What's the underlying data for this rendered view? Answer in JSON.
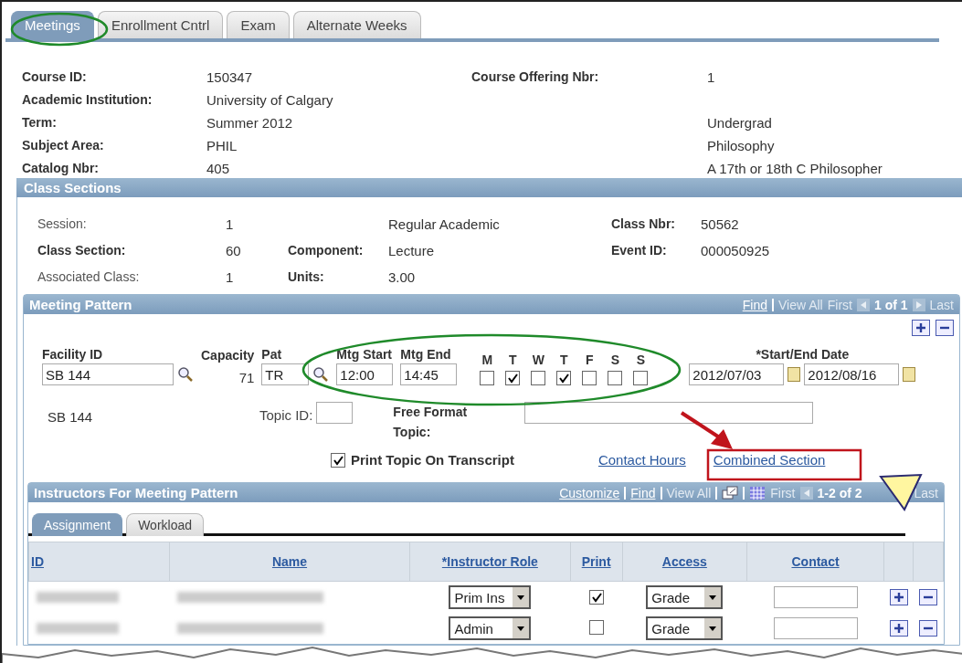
{
  "tabs": [
    {
      "label": "Meetings",
      "selected": true
    },
    {
      "label": "Enrollment Cntrl",
      "selected": false
    },
    {
      "label": "Exam",
      "selected": false
    },
    {
      "label": "Alternate Weeks",
      "selected": false
    }
  ],
  "course": [
    {
      "label": "Course ID:",
      "value": "150347",
      "right_label": "Course Offering Nbr:",
      "right_value": "1"
    },
    {
      "label": "Academic Institution:",
      "value": "University of Calgary"
    },
    {
      "label": "Term:",
      "value": "Summer 2012",
      "right_value": "Undergrad"
    },
    {
      "label": "Subject Area:",
      "value": "PHIL",
      "right_value": "Philosophy"
    },
    {
      "label": "Catalog Nbr:",
      "value": "405",
      "right_value": "A 17th or 18th C Philosopher"
    }
  ],
  "class_sections": {
    "title": "Class Sections",
    "rows": [
      {
        "label": "Session:",
        "bold": false,
        "value": "1",
        "mid_value": "Regular Academic",
        "right_label": "Class Nbr:",
        "right_value": "50562"
      },
      {
        "label": "Class Section:",
        "bold": true,
        "value": "60",
        "mid_label": "Component:",
        "mid_value": "Lecture",
        "right_label": "Event ID:",
        "right_value": "000050925"
      },
      {
        "label": "Associated Class:",
        "bold": false,
        "value": "1",
        "mid_label": "Units:",
        "mid_value": "3.00"
      }
    ]
  },
  "meeting_pattern": {
    "title": "Meeting Pattern",
    "nav": {
      "find": "Find",
      "view_all": "View All",
      "first": "First",
      "count": "1 of 1",
      "last": "Last"
    },
    "facility_label": "Facility ID",
    "facility": "SB 144",
    "capacity_label": "Capacity",
    "capacity": "71",
    "pat_label": "Pat",
    "pat": "TR",
    "start_label": "Mtg Start",
    "start": "12:00",
    "end_label": "Mtg End",
    "end": "14:45",
    "days": [
      {
        "label": "M",
        "checked": false
      },
      {
        "label": "T",
        "checked": true
      },
      {
        "label": "W",
        "checked": false
      },
      {
        "label": "T",
        "checked": true
      },
      {
        "label": "F",
        "checked": false
      },
      {
        "label": "S",
        "checked": false
      },
      {
        "label": "S",
        "checked": false
      }
    ],
    "date_label": "*Start/End Date",
    "start_date": "2012/07/03",
    "end_date": "2012/08/16",
    "facility_description": "SB  144",
    "topic_id_label": "Topic ID:",
    "free_topic_label": "Free Format Topic:",
    "print_topic": {
      "label": "Print Topic On Transcript",
      "checked": true
    },
    "links": [
      "Contact Hours",
      "Combined Section"
    ]
  },
  "instructors": {
    "title": "Instructors For Meeting Pattern",
    "nav": {
      "customize": "Customize",
      "find": "Find",
      "view_all": "View All",
      "first": "First",
      "count": "1-2 of 2",
      "last": "Last"
    },
    "subtabs": [
      {
        "label": "Assignment",
        "selected": true
      },
      {
        "label": "Workload",
        "selected": false
      }
    ],
    "columns": [
      "ID",
      "Name",
      "*Instructor Role",
      "Print",
      "Access",
      "Contact"
    ],
    "rows": [
      {
        "role": "Prim Ins",
        "print": true,
        "access": "Grade"
      },
      {
        "role": "Admin",
        "print": false,
        "access": "Grade"
      }
    ]
  }
}
